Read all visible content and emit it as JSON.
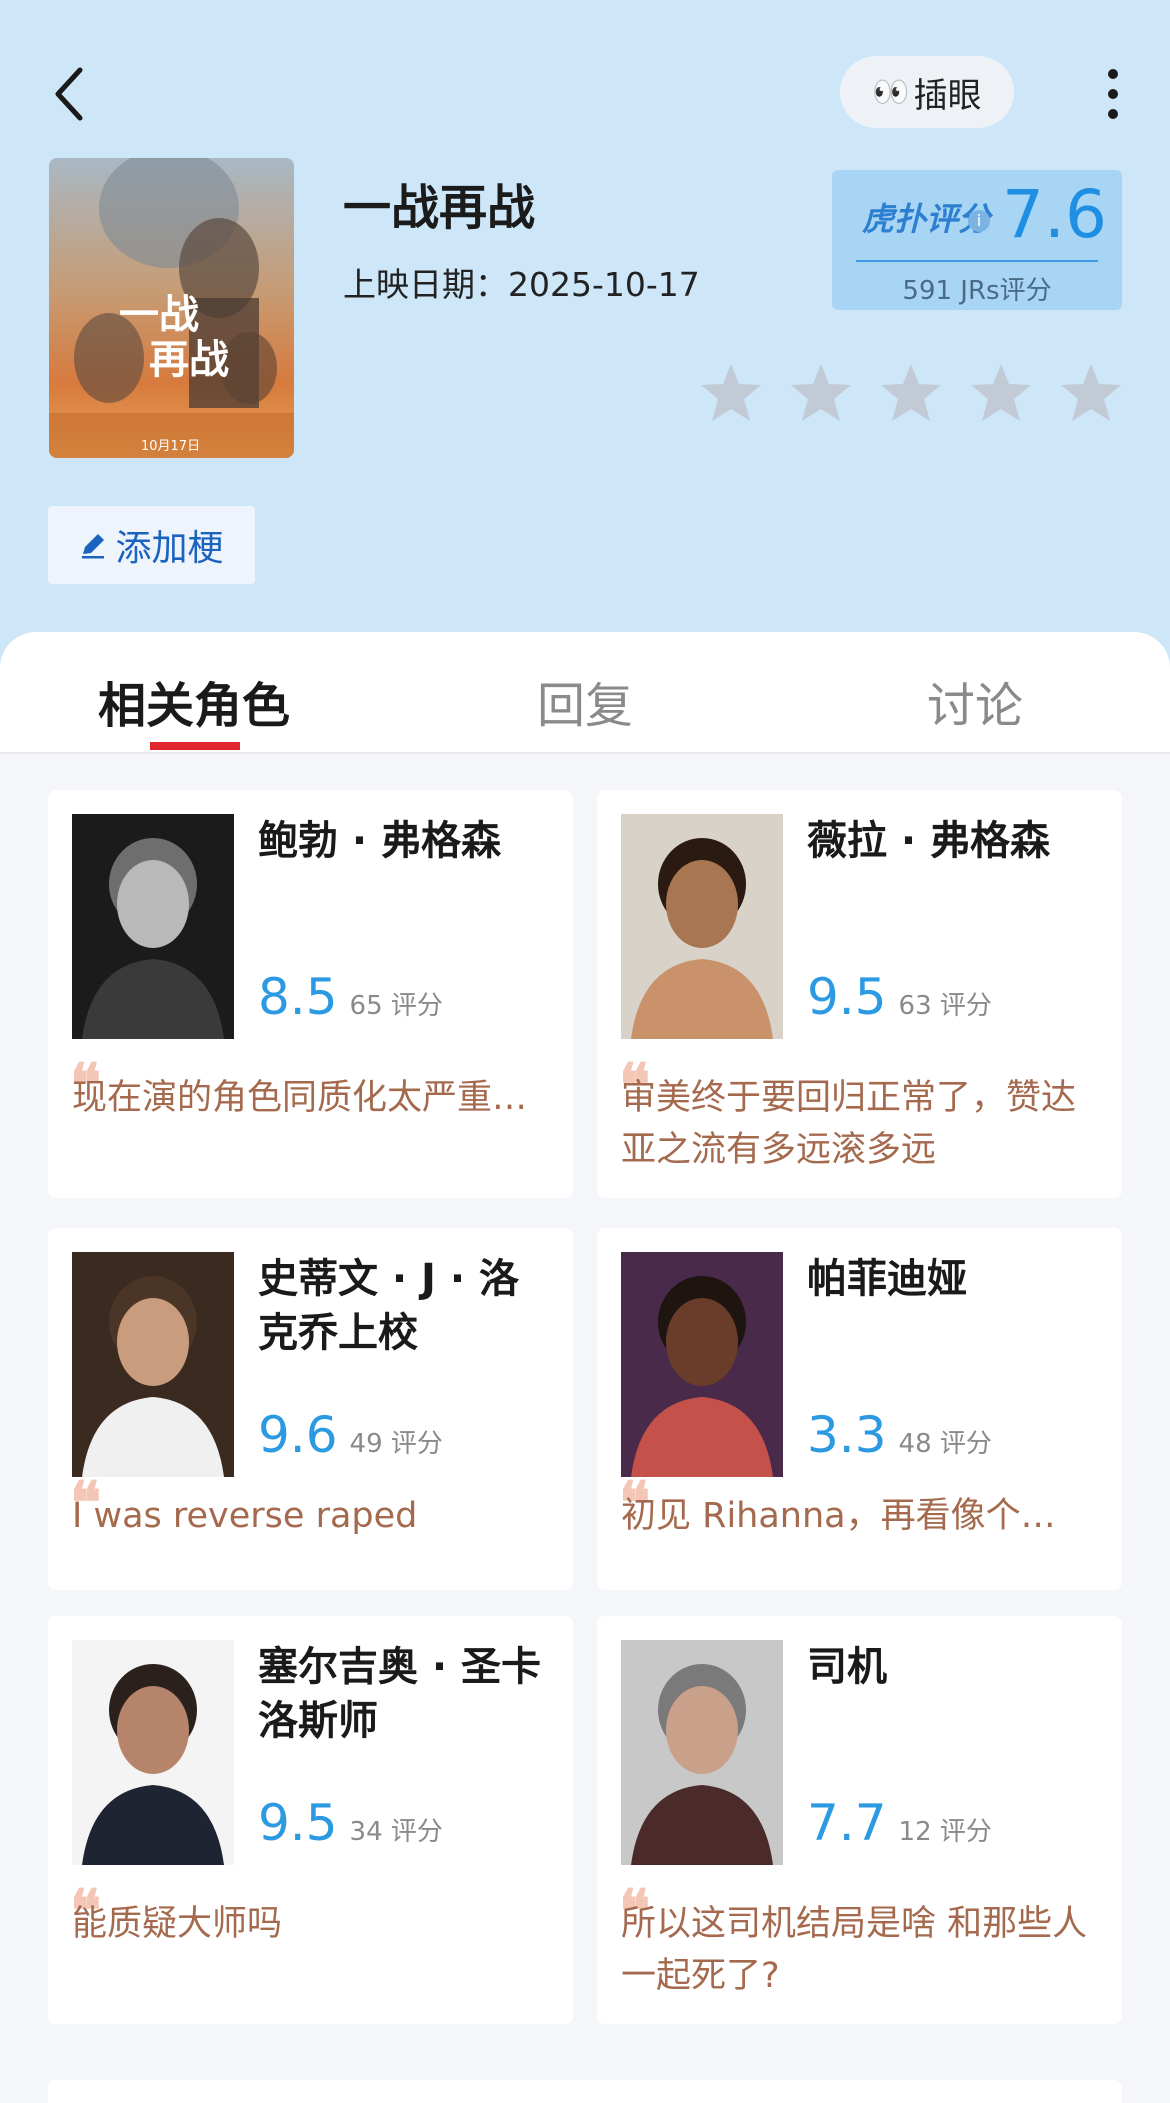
{
  "header": {
    "peek_label": "插眼",
    "peek_emoji": "👀",
    "movie_title": "一战再战",
    "release_label": "上映日期：",
    "release_date": "2025-10-17",
    "poster_title": "一战\n再战",
    "poster_date": "10月17日",
    "score": {
      "brand": "虎扑评分",
      "value": "7.6",
      "count_text": "591 JRs评分"
    },
    "stars_total": 5,
    "add_meme_label": "添加梗"
  },
  "tabs": [
    {
      "label": "相关角色",
      "active": true
    },
    {
      "label": "回复",
      "active": false
    },
    {
      "label": "讨论",
      "active": false
    }
  ],
  "characters": [
    {
      "name": "鲍勃 · 弗格森",
      "rating": "8.5",
      "count": "65 评分",
      "comment": "现在演的角色同质化太严重了吧",
      "avatar_style": "bw"
    },
    {
      "name": "薇拉 · 弗格森",
      "rating": "9.5",
      "count": "63 评分",
      "comment": "审美终于要回归正常了，赞达亚之流有多远滚多远",
      "avatar_style": "gold"
    },
    {
      "name": "史蒂文 · J · 洛克乔上校",
      "rating": "9.6",
      "count": "49 评分",
      "comment": "I was reverse raped",
      "avatar_style": "dark"
    },
    {
      "name": "帕菲迪娅",
      "rating": "3.3",
      "count": "48 评分",
      "comment": "初见 Rihanna，再看像个…",
      "avatar_style": "purple"
    },
    {
      "name": "塞尔吉奥 · 圣卡洛斯师",
      "rating": "9.5",
      "count": "34 评分",
      "comment": "能质疑大师吗",
      "avatar_style": "suit"
    },
    {
      "name": "司机",
      "rating": "7.7",
      "count": "12 评分",
      "comment": "所以这司机结局是啥 和那些人一起死了?",
      "avatar_style": "grey"
    }
  ],
  "colors": {
    "header_bg": "#cde6f8",
    "rating_blue": "#2b9ae2",
    "comment_brown": "#a56a4e",
    "tab_underline": "#e0262c"
  }
}
